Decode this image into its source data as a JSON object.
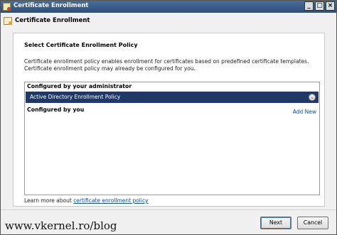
{
  "window": {
    "title": "Certificate Enrollment"
  },
  "header": {
    "title": "Certificate Enrollment"
  },
  "main": {
    "section_title": "Select Certificate Enrollment Policy",
    "description": "Certificate enrollment policy enables enrollment for certificates based on predefined certificate templates. Certificate enrollment policy may already be configured for you.",
    "groups": {
      "admin_label": "Configured by your administrator",
      "policy_item": "Active Directory Enrollment Policy",
      "user_label": "Configured by you",
      "add_new": "Add New"
    },
    "learn_more_prefix": "Learn more about ",
    "learn_more_link": "certificate enrollment policy"
  },
  "footer": {
    "next_label": "Next",
    "cancel_label": "Cancel"
  },
  "watermark": "www.vkernel.ro/blog",
  "icons": [
    "app-certificate-icon",
    "minimize-icon",
    "maximize-icon",
    "close-icon",
    "header-certificate-icon",
    "chevron-expand-icon"
  ],
  "colors": {
    "selection": "#1e3868",
    "link": "#0a4fb0",
    "titlebar": "#2f4f7a"
  }
}
